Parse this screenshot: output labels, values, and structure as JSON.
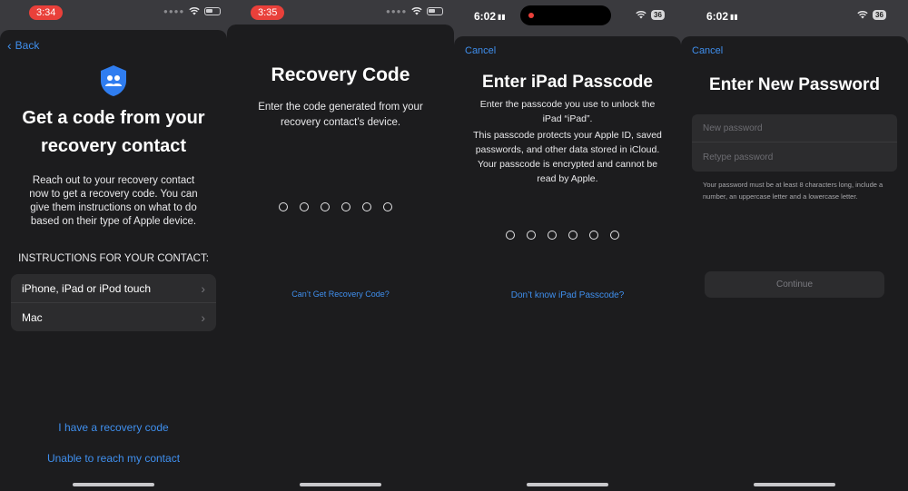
{
  "colors": {
    "accent": "#3f8fee",
    "sheet_bg": "#1c1c1e",
    "record_red": "#e9403a"
  },
  "panel1": {
    "time": "3:34",
    "back_label": "Back",
    "icon": "people-shield-icon",
    "title": "Get a code from your recovery contact",
    "body": "Reach out to your recovery contact now to get a recovery code. You can give them instructions on what to do based on their type of Apple device.",
    "section_header": "INSTRUCTIONS FOR YOUR CONTACT:",
    "options": [
      {
        "label": "iPhone, iPad or iPod touch"
      },
      {
        "label": "Mac"
      }
    ],
    "have_code_link": "I have a recovery code",
    "unable_link": "Unable to reach my contact"
  },
  "panel2": {
    "time": "3:35",
    "title": "Recovery Code",
    "body": "Enter the code generated from your recovery contact’s device.",
    "digits": 6,
    "cant_get_link": "Can’t Get Recovery Code?"
  },
  "panel3": {
    "time": "6:02",
    "battery": "36",
    "cancel_label": "Cancel",
    "title": "Enter iPad Passcode",
    "body_line1": "Enter the passcode you use to unlock the iPad “iPad”.",
    "body_line2": "This passcode protects your Apple ID, saved passwords, and other data stored in iCloud. Your passcode is encrypted and cannot be read by Apple.",
    "digits": 6,
    "dont_know_link": "Don’t know iPad Passcode?"
  },
  "panel4": {
    "time": "6:02",
    "battery": "36",
    "cancel_label": "Cancel",
    "title": "Enter New Password",
    "new_password_placeholder": "New password",
    "retype_password_placeholder": "Retype password",
    "hint": "Your password must be at least 8 characters long, include a number, an uppercase letter and a lowercase letter.",
    "continue_label": "Continue"
  }
}
